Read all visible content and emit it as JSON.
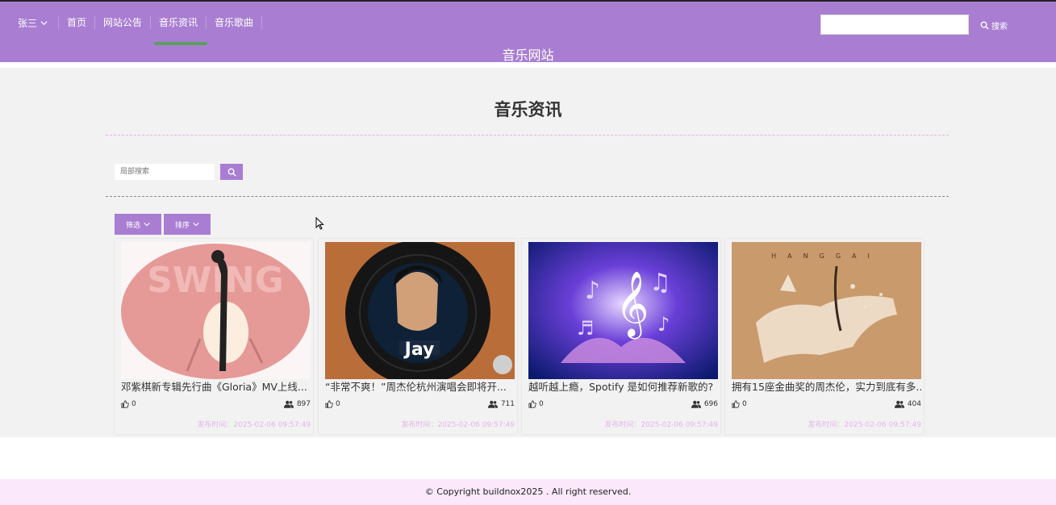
{
  "header": {
    "user_name": "张三",
    "nav": [
      {
        "label": "首页"
      },
      {
        "label": "网站公告"
      },
      {
        "label": "音乐资讯",
        "active": true
      },
      {
        "label": "音乐歌曲"
      }
    ],
    "site_title": "音乐网站",
    "search_value": "",
    "search_button_label": "搜索"
  },
  "main": {
    "page_title": "音乐资讯",
    "local_search_placeholder": "局部搜索",
    "filter_label": "筛选",
    "sort_label": "排序"
  },
  "cards": [
    {
      "title": "邓紫棋新专辑先行曲《Gloria》MV上线...",
      "likes": "0",
      "views": "897",
      "time": "发布时间：2025-02-06 09:57:49",
      "thumb_text": "SWING"
    },
    {
      "title": "“非常不爽！”周杰伦杭州演唱会即将开...",
      "likes": "0",
      "views": "711",
      "time": "发布时间：2025-02-06 09:57:49",
      "thumb_text": "Jay"
    },
    {
      "title": "越听越上瘾，Spotify 是如何推荐新歌的?",
      "likes": "0",
      "views": "696",
      "time": "发布时间：2025-02-06 09:57:49",
      "thumb_text": ""
    },
    {
      "title": "拥有15座金曲奖的周杰伦，实力到底有多...",
      "likes": "0",
      "views": "404",
      "time": "发布时间：2025-02-06 09:57:49",
      "thumb_text": "HANGGAI"
    }
  ],
  "footer": {
    "copyright": "© Copyright buildnox2025 . All right reserved."
  },
  "colors": {
    "accent": "#a97ed2",
    "active_underline": "#5aa05c",
    "time_text": "#e4b6ea",
    "footer_bg": "#fbe9fb"
  }
}
